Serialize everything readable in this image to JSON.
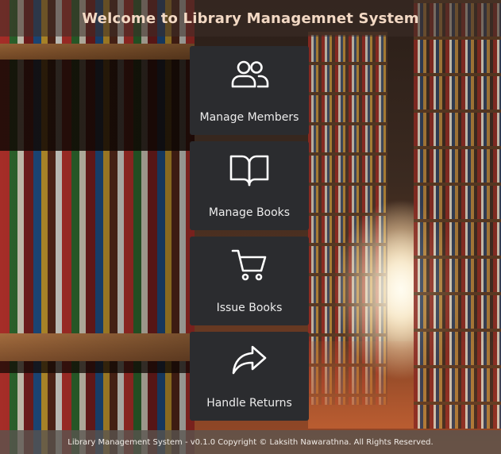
{
  "header": {
    "title": "Welcome to Library Managemnet System"
  },
  "menu": {
    "items": [
      {
        "label": "Manage Members",
        "icon": "users-icon"
      },
      {
        "label": "Manage Books",
        "icon": "book-open-icon"
      },
      {
        "label": "Issue Books",
        "icon": "shopping-cart-icon"
      },
      {
        "label": "Handle Returns",
        "icon": "share-arrow-icon"
      }
    ]
  },
  "footer": {
    "text": "Library Management System - v0.1.0 Copyright © Laksith Nawarathna. All Rights Reserved."
  },
  "colors": {
    "tile": "#2b2c2f",
    "title": "#f3d9c4",
    "icon": "#ffffff"
  }
}
